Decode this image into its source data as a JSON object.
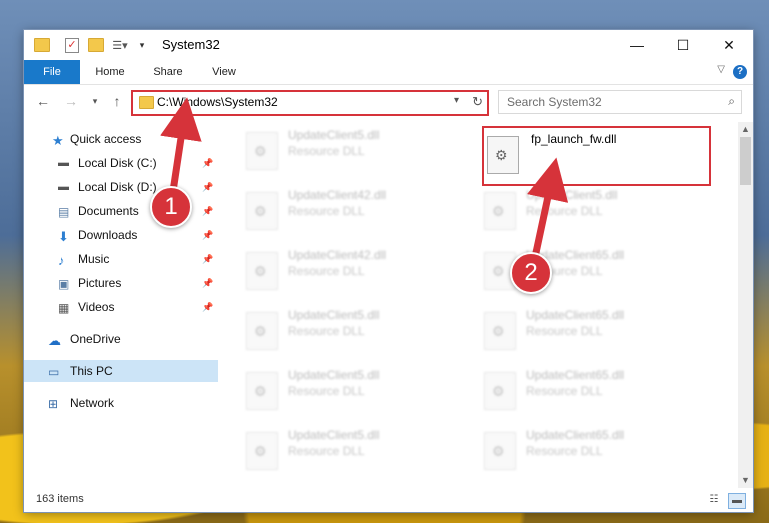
{
  "window": {
    "title": "System32",
    "controls": {
      "minimize": "—",
      "maximize": "☐",
      "close": "✕"
    }
  },
  "ribbon": {
    "tabs": [
      "File",
      "Home",
      "Share",
      "View"
    ]
  },
  "address_bar": {
    "path": "C:\\Windows\\System32",
    "search_placeholder": "Search System32"
  },
  "sidebar": {
    "items": [
      {
        "label": "Quick access",
        "icon": "star-icon",
        "pinned": false
      },
      {
        "label": "Local Disk (C:)",
        "icon": "drive-icon",
        "pinned": true
      },
      {
        "label": "Local Disk (D:)",
        "icon": "drive-icon",
        "pinned": true
      },
      {
        "label": "Documents",
        "icon": "documents-icon",
        "pinned": true
      },
      {
        "label": "Downloads",
        "icon": "download-icon",
        "pinned": true
      },
      {
        "label": "Music",
        "icon": "music-icon",
        "pinned": true
      },
      {
        "label": "Pictures",
        "icon": "pictures-icon",
        "pinned": true
      },
      {
        "label": "Videos",
        "icon": "videos-icon",
        "pinned": true
      },
      {
        "label": "OneDrive",
        "icon": "cloud-icon",
        "pinned": false
      },
      {
        "label": "This PC",
        "icon": "computer-icon",
        "pinned": false,
        "selected": true
      },
      {
        "label": "Network",
        "icon": "network-icon",
        "pinned": false
      }
    ]
  },
  "files": {
    "left_column": [
      {
        "name": "UpdateClient5.dll",
        "type": "Resource DLL"
      },
      {
        "name": "UpdateClient42.dll",
        "type": "Resource DLL"
      },
      {
        "name": "UpdateClient42.dll",
        "type": "Resource DLL"
      },
      {
        "name": "UpdateClient5.dll",
        "type": "Resource DLL"
      },
      {
        "name": "UpdateClient5.dll",
        "type": "Resource DLL"
      },
      {
        "name": "UpdateClient5.dll",
        "type": "Resource DLL"
      }
    ],
    "right_column": [
      {
        "name": "UpdateClient5.dll",
        "type": "Resource DLL"
      },
      {
        "name": "UpdateClient65.dll",
        "type": "Resource DLL"
      },
      {
        "name": "UpdateClient65.dll",
        "type": "Resource DLL"
      },
      {
        "name": "UpdateClient65.dll",
        "type": "Resource DLL"
      },
      {
        "name": "UpdateClient65.dll",
        "type": "Resource DLL"
      }
    ],
    "highlighted": {
      "name": "fp_launch_fw.dll"
    }
  },
  "status": {
    "item_count": "163 items"
  },
  "annotations": {
    "step1": "1",
    "step2": "2",
    "color": "#d6333a"
  }
}
